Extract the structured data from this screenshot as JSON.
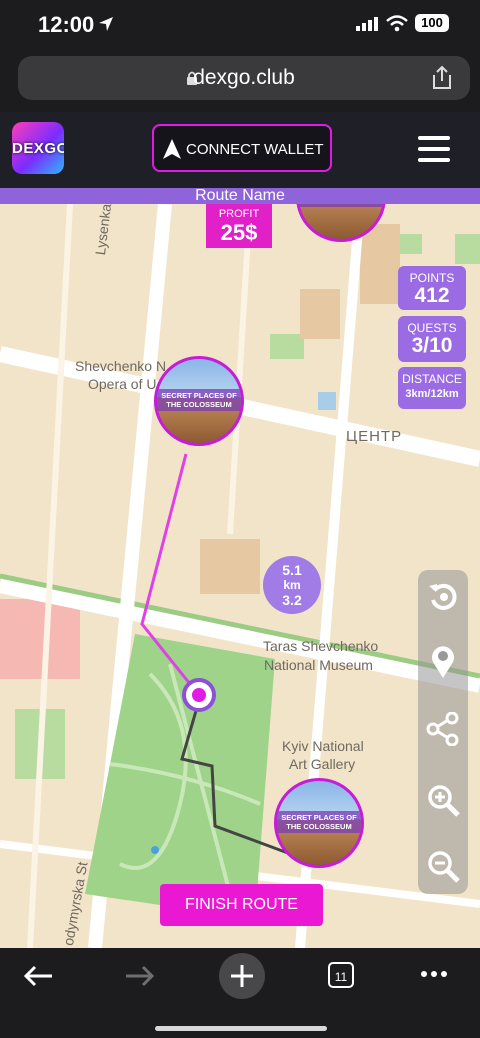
{
  "status_bar": {
    "time": "12:00",
    "battery": "100"
  },
  "browser": {
    "url": "dexgo.club",
    "tabs_count": "11"
  },
  "app": {
    "logo_text": "DEXGO",
    "connect_wallet": "CONNECT WALLET",
    "route_name": "Route Name",
    "profit_label": "PROFIT",
    "profit_value": "25$",
    "stats": {
      "points_label": "POINTS",
      "points_value": "412",
      "quests_label": "QUESTS",
      "quests_value": "3/10",
      "distance_label": "DISTANCE",
      "distance_value": "3km/12km"
    },
    "poi_caption": "SECRET PLACES OF THE COLOSSEUM",
    "distance_badge": {
      "top": "5.1",
      "unit": "km",
      "bottom": "3.2"
    },
    "finish_route": "FINISH ROUTE"
  },
  "map_labels": {
    "lysenka": "Lysenka St",
    "opera_1": "Shevchenko N",
    "opera_2": "Opera of U",
    "center": "ЦЕНТР",
    "museum_1": "Taras Shevchenko",
    "museum_2": "National Museum",
    "gallery_1": "Kyiv National",
    "gallery_2": "Art Gallery",
    "volodymyrska": "odymyrska St"
  },
  "colors": {
    "accent": "#e21ae8",
    "purple": "#9b6be3",
    "route": "#e040e8"
  }
}
